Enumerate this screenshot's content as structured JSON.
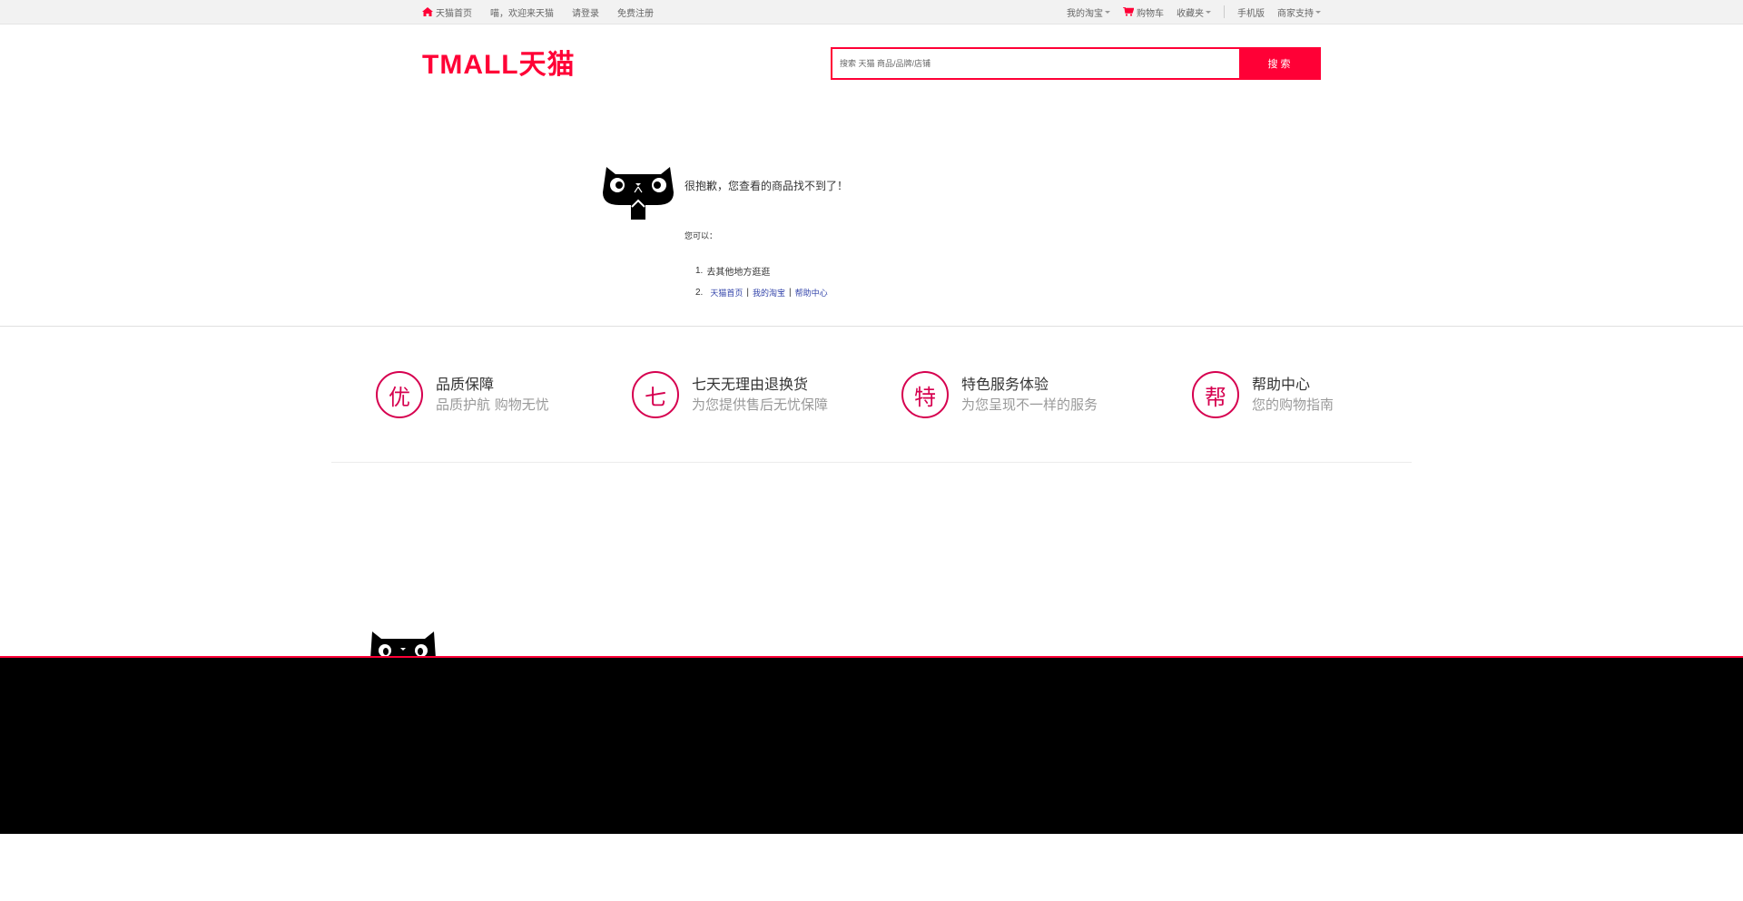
{
  "topbar": {
    "left": [
      {
        "label": "天猫首页",
        "icon": "home-icon"
      },
      {
        "label": "喵，欢迎来天猫"
      },
      {
        "label": "请登录"
      },
      {
        "label": "免费注册"
      }
    ],
    "right": [
      {
        "label": "我的淘宝",
        "dropdown": true
      },
      {
        "label": "购物车",
        "icon": "cart-icon"
      },
      {
        "label": "收藏夹",
        "dropdown": true
      },
      {
        "label": "手机版"
      },
      {
        "label": "商家支持",
        "dropdown": true
      }
    ]
  },
  "header": {
    "logo": "TMALL天猫",
    "search_placeholder": "搜索 天猫 商品/品牌/店铺",
    "search_button": "搜 索"
  },
  "error": {
    "title": "很抱歉，您查看的商品找不到了！",
    "label": "您可以：",
    "items": [
      {
        "num": "1.",
        "text": "去其他地方逛逛"
      },
      {
        "num": "2.",
        "links": [
          "天猫首页",
          "我的淘宝",
          "帮助中心"
        ]
      }
    ]
  },
  "services": [
    {
      "icon_char": "优",
      "icon": "quality-icon",
      "title": "品质保障",
      "sub": "品质护航 购物无忧"
    },
    {
      "icon_char": "七",
      "icon": "seven-day-icon",
      "title": "七天无理由退换货",
      "sub": "为您提供售后无忧保障"
    },
    {
      "icon_char": "特",
      "icon": "special-icon",
      "title": "特色服务体验",
      "sub": "为您呈现不一样的服务"
    },
    {
      "icon_char": "帮",
      "icon": "help-icon",
      "title": "帮助中心",
      "sub": "您的购物指南"
    }
  ],
  "colors": {
    "brand": "#ff0036",
    "service_accent": "#d6004f",
    "footer_bg": "#000000"
  }
}
